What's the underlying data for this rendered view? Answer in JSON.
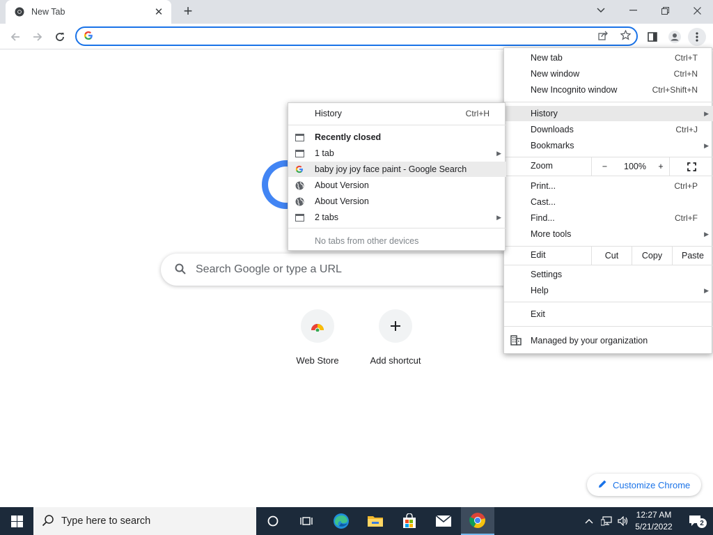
{
  "browser": {
    "tab_title": "New Tab",
    "omnibox_value": ""
  },
  "ntp": {
    "search_placeholder": "Search Google or type a URL",
    "shortcuts": [
      {
        "label": "Web Store",
        "icon": "web-store-icon"
      },
      {
        "label": "Add shortcut",
        "icon": "plus-icon"
      }
    ],
    "customize_label": "Customize Chrome"
  },
  "menu": {
    "items": [
      {
        "label": "New tab",
        "shortcut": "Ctrl+T"
      },
      {
        "label": "New window",
        "shortcut": "Ctrl+N"
      },
      {
        "label": "New Incognito window",
        "shortcut": "Ctrl+Shift+N"
      },
      {
        "label": "History"
      },
      {
        "label": "Downloads",
        "shortcut": "Ctrl+J"
      },
      {
        "label": "Bookmarks"
      },
      {
        "label": "Print...",
        "shortcut": "Ctrl+P"
      },
      {
        "label": "Cast..."
      },
      {
        "label": "Find...",
        "shortcut": "Ctrl+F"
      },
      {
        "label": "More tools"
      },
      {
        "label": "Settings"
      },
      {
        "label": "Help"
      },
      {
        "label": "Exit"
      }
    ],
    "zoom": {
      "label": "Zoom",
      "minus": "−",
      "value": "100%",
      "plus": "+"
    },
    "edit": {
      "label": "Edit",
      "cut": "Cut",
      "copy": "Copy",
      "paste": "Paste"
    },
    "managed": "Managed by your organization"
  },
  "history_submenu": {
    "history": {
      "label": "History",
      "shortcut": "Ctrl+H"
    },
    "recently_closed": "Recently closed",
    "items": [
      {
        "label": "1 tab",
        "icon": "tab-icon"
      },
      {
        "label": "baby joy joy face paint - Google Search",
        "icon": "google-favicon"
      },
      {
        "label": "About Version",
        "icon": "globe-icon"
      },
      {
        "label": "About Version",
        "icon": "globe-icon"
      },
      {
        "label": "2 tabs",
        "icon": "tab-icon"
      }
    ],
    "no_other_devices": "No tabs from other devices"
  },
  "taskbar": {
    "search_placeholder": "Type here to search",
    "time": "12:27 AM",
    "date": "5/21/2022",
    "notification_count": "2"
  },
  "colors": {
    "accent": "#1a73e8",
    "taskbar": "#1c2a3a",
    "tabstrip": "#dee1e6"
  }
}
